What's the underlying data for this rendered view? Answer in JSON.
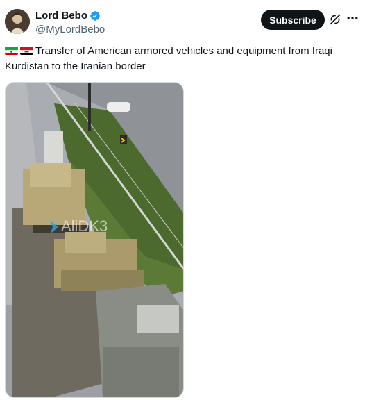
{
  "author": {
    "display_name": "Lord Bebo",
    "handle": "@MyLordBebo",
    "verified": true,
    "avatar_icon": "avatar-image"
  },
  "actions": {
    "subscribe_label": "Subscribe",
    "grok_icon": "grok-icon",
    "more_icon": "more-icon"
  },
  "post": {
    "flags": [
      "flag-iran-icon",
      "flag-iraq-icon"
    ],
    "text": "Transfer of American armored vehicles and equipment from Iraqi Kurdistan to the Iranian border"
  },
  "media": {
    "type": "video",
    "watermark": "AliDK3"
  },
  "colors": {
    "accent_blue": "#1d9bf0",
    "text_primary": "#0f1419",
    "text_secondary": "#536471",
    "button_bg": "#0f1419"
  }
}
